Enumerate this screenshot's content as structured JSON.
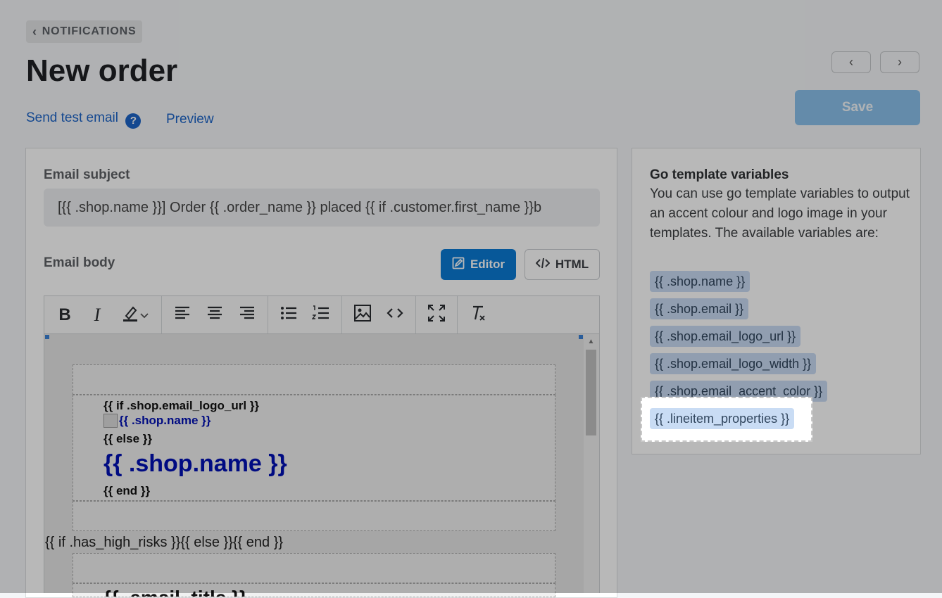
{
  "breadcrumb": {
    "label": "NOTIFICATIONS"
  },
  "page": {
    "title": "New order"
  },
  "links": {
    "send_test": "Send test email",
    "help": "?",
    "preview": "Preview"
  },
  "nav": {
    "prev": "‹",
    "next": "›"
  },
  "save": {
    "label": "Save"
  },
  "email_subject": {
    "label": "Email subject",
    "value": "[{{ .shop.name }}] Order {{ .order_name }} placed {{ if .customer.first_name }}b"
  },
  "email_body": {
    "label": "Email body",
    "editor_label": "Editor",
    "html_label": "HTML"
  },
  "toolbar": {
    "bold": "B",
    "italic": "I"
  },
  "canvas": {
    "line1": "{{ if .shop.email_logo_url }}",
    "line2": "{{ .shop.name }}",
    "line3": "{{ else }}",
    "line4": "{{ .shop.name }}",
    "line5": "{{ end }}",
    "line6": "{{ if .has_high_risks }}{{ else }}{{ end }}",
    "line7": "{{ .email_title }}"
  },
  "variables": {
    "title": "Go template variables",
    "description": "You can use go template variables to output an accent colour and logo image in your templates. The available variables are:",
    "items": [
      "{{ .shop.name }}",
      "{{ .shop.email }}",
      "{{ .shop.email_logo_url }}",
      "{{ .shop.email_logo_width }}",
      "{{ .shop.email_accent_color }}",
      "{{ .lineitem_properties }}"
    ]
  },
  "colors": {
    "accent": "#0a7ad5",
    "link": "#1c64c8",
    "chip": "#c9dcf4"
  }
}
